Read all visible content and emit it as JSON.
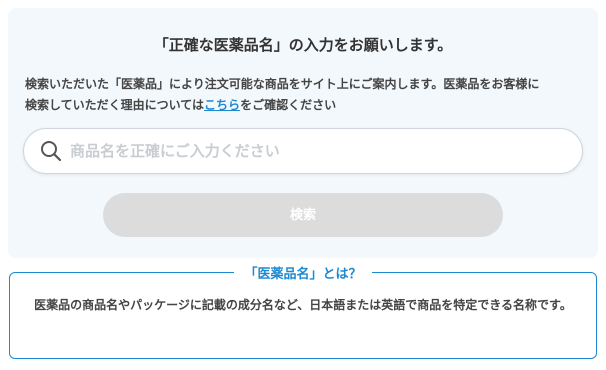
{
  "header": {
    "title": "「正確な医薬品名」の入力をお願いします。"
  },
  "description": {
    "line1": "検索いただいた「医薬品」により注文可能な商品をサイト上にご案内します。医薬品をお客様に",
    "line2_before": "検索していただく理由については",
    "link": "こちら",
    "line2_after": "をご確認ください"
  },
  "search": {
    "placeholder": "商品名を正確にご入力ください",
    "value": "",
    "icon": "search-icon"
  },
  "submit": {
    "label": "検索",
    "state": "disabled"
  },
  "info_box": {
    "title": "「医薬品名」とは？",
    "body": "医薬品の商品名やパッケージに記載の成分名など、日本語または英語で商品を特定できる名称です。"
  },
  "colors": {
    "accent": "#1b8ad3",
    "panel_bg": "#f3f8fc",
    "button_disabled": "#dcdcdc"
  }
}
